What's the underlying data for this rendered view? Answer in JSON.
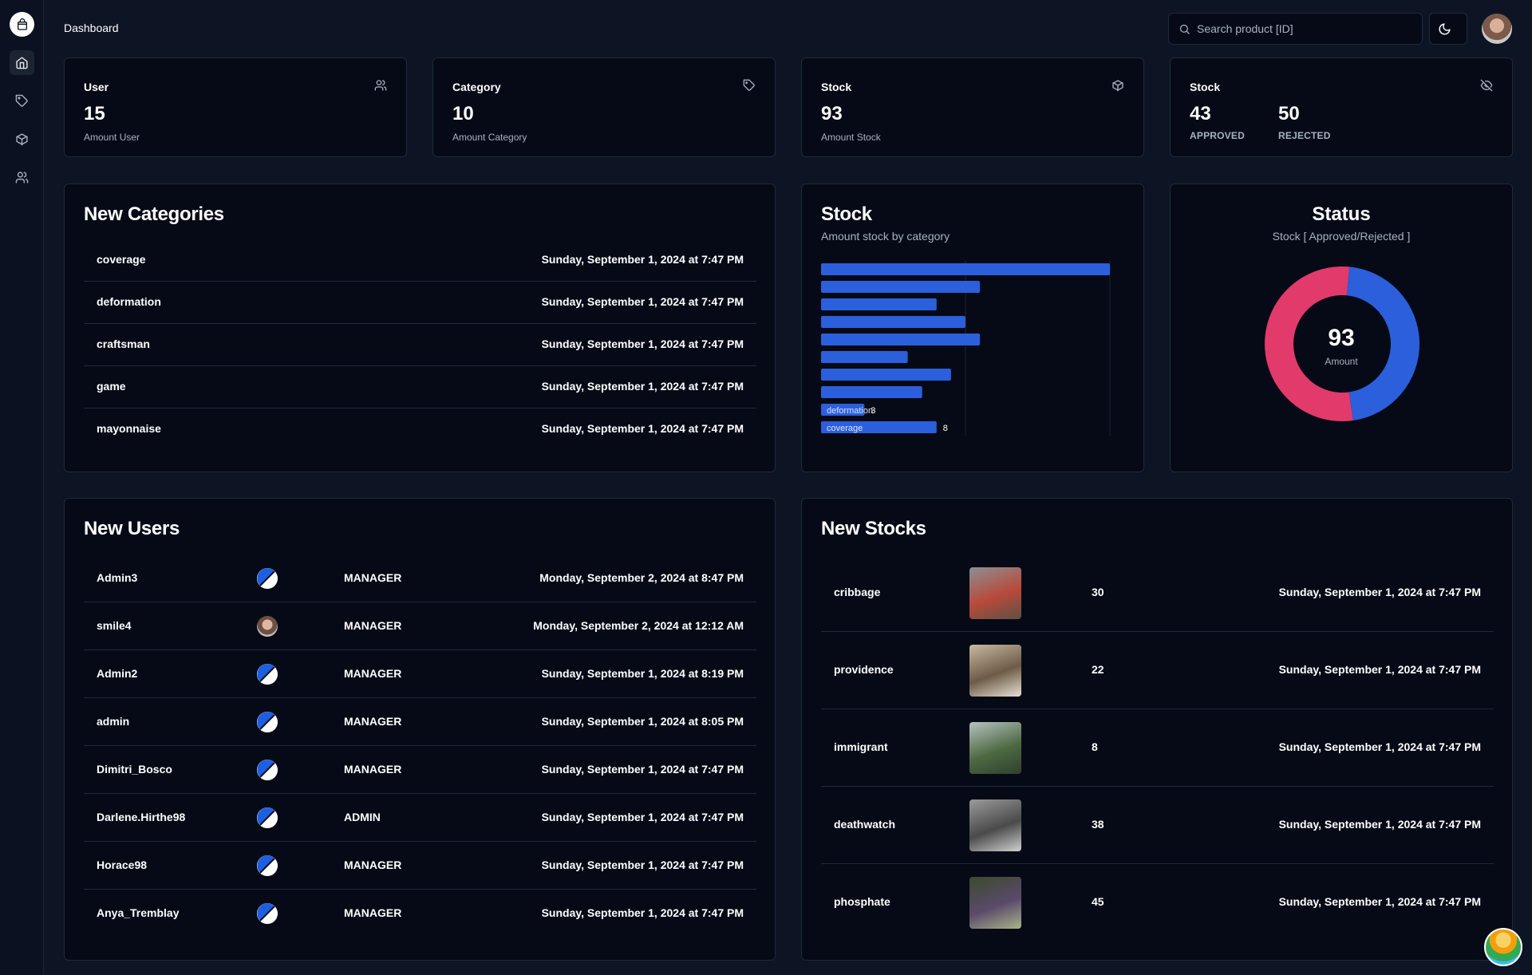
{
  "header": {
    "title": "Dashboard",
    "search_placeholder": "Search product [ID]"
  },
  "sidebar": {
    "items": [
      {
        "icon": "home-icon",
        "active": true
      },
      {
        "icon": "tag-icon",
        "active": false
      },
      {
        "icon": "box-icon",
        "active": false
      },
      {
        "icon": "users-icon",
        "active": false
      }
    ]
  },
  "stats": {
    "user": {
      "label": "User",
      "value": "15",
      "sub": "Amount User",
      "icon": "users-icon"
    },
    "category": {
      "label": "Category",
      "value": "10",
      "sub": "Amount Category",
      "icon": "tag-icon"
    },
    "stock": {
      "label": "Stock",
      "value": "93",
      "sub": "Amount Stock",
      "icon": "box-icon"
    },
    "status": {
      "label": "Stock",
      "approved_value": "43",
      "approved_label": "APPROVED",
      "rejected_value": "50",
      "rejected_label": "REJECTED",
      "icon": "eye-off-icon"
    }
  },
  "new_categories": {
    "title": "New Categories",
    "rows": [
      {
        "name": "coverage",
        "date": "Sunday, September 1, 2024 at 7:47 PM"
      },
      {
        "name": "deformation",
        "date": "Sunday, September 1, 2024 at 7:47 PM"
      },
      {
        "name": "craftsman",
        "date": "Sunday, September 1, 2024 at 7:47 PM"
      },
      {
        "name": "game",
        "date": "Sunday, September 1, 2024 at 7:47 PM"
      },
      {
        "name": "mayonnaise",
        "date": "Sunday, September 1, 2024 at 7:47 PM"
      }
    ]
  },
  "stock_chart": {
    "title": "Stock",
    "subtitle": "Amount stock by category"
  },
  "status_chart": {
    "title": "Status",
    "subtitle": "Stock [ Approved/Rejected ]",
    "center_value": "93",
    "center_label": "Amount"
  },
  "chart_data": [
    {
      "type": "bar",
      "orientation": "horizontal",
      "categories": [
        "",
        "",
        "",
        "",
        "",
        "",
        "",
        "",
        "deformation",
        "coverage"
      ],
      "values": [
        20,
        11,
        8,
        10,
        11,
        6,
        9,
        7,
        3,
        8
      ],
      "data_labels": [
        "",
        "",
        "",
        "",
        "",
        "",
        "",
        "",
        "3",
        "8"
      ],
      "xlim": [
        0,
        20
      ],
      "grid": true,
      "color": "#2b5fdc"
    },
    {
      "type": "pie",
      "donut": true,
      "labels": [
        "Approved",
        "Rejected"
      ],
      "values": [
        43,
        50
      ],
      "colors": [
        "#2b5fdc",
        "#e23a6a"
      ]
    }
  ],
  "new_users": {
    "title": "New Users",
    "rows": [
      {
        "name": "Admin3",
        "avatar": "default",
        "role": "MANAGER",
        "date": "Monday, September 2, 2024 at 8:47 PM"
      },
      {
        "name": "smile4",
        "avatar": "photo",
        "role": "MANAGER",
        "date": "Monday, September 2, 2024 at 12:12 AM"
      },
      {
        "name": "Admin2",
        "avatar": "default",
        "role": "MANAGER",
        "date": "Sunday, September 1, 2024 at 8:19 PM"
      },
      {
        "name": "admin",
        "avatar": "default",
        "role": "MANAGER",
        "date": "Sunday, September 1, 2024 at 8:05 PM"
      },
      {
        "name": "Dimitri_Bosco",
        "avatar": "default",
        "role": "MANAGER",
        "date": "Sunday, September 1, 2024 at 7:47 PM"
      },
      {
        "name": "Darlene.Hirthe98",
        "avatar": "default",
        "role": "ADMIN",
        "date": "Sunday, September 1, 2024 at 7:47 PM"
      },
      {
        "name": "Horace98",
        "avatar": "default",
        "role": "MANAGER",
        "date": "Sunday, September 1, 2024 at 7:47 PM"
      },
      {
        "name": "Anya_Tremblay",
        "avatar": "default",
        "role": "MANAGER",
        "date": "Sunday, September 1, 2024 at 7:47 PM"
      }
    ]
  },
  "new_stocks": {
    "title": "New Stocks",
    "rows": [
      {
        "name": "cribbage",
        "qty": "30",
        "date": "Sunday, September 1, 2024 at 7:47 PM",
        "thumb_colors": [
          "#8c8f93",
          "#b84a3a",
          "#5d5145"
        ]
      },
      {
        "name": "providence",
        "qty": "22",
        "date": "Sunday, September 1, 2024 at 7:47 PM",
        "thumb_colors": [
          "#c9b9a0",
          "#6d5b48",
          "#e8e1d3"
        ]
      },
      {
        "name": "immigrant",
        "qty": "8",
        "date": "Sunday, September 1, 2024 at 7:47 PM",
        "thumb_colors": [
          "#b7c2bf",
          "#4d6a44",
          "#2f3f2c"
        ]
      },
      {
        "name": "deathwatch",
        "qty": "38",
        "date": "Sunday, September 1, 2024 at 7:47 PM",
        "thumb_colors": [
          "#9b9b9b",
          "#4a4a4a",
          "#d0d0d0"
        ]
      },
      {
        "name": "phosphate",
        "qty": "45",
        "date": "Sunday, September 1, 2024 at 7:47 PM",
        "thumb_colors": [
          "#3c4a2c",
          "#5a4a6a",
          "#a9b48a"
        ]
      }
    ]
  }
}
